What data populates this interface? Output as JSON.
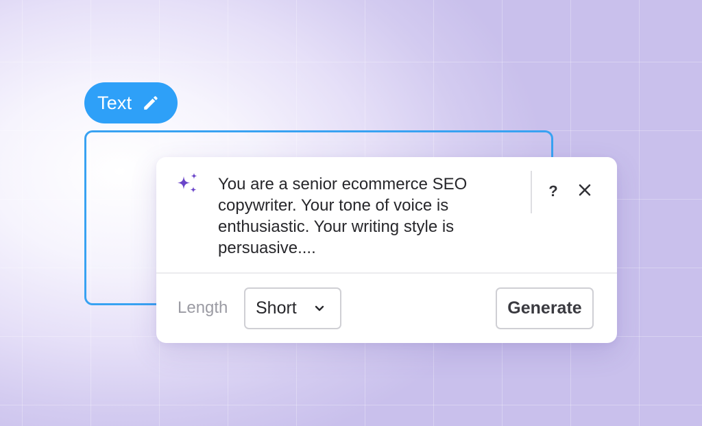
{
  "chip": {
    "label": "Text",
    "icon": "pencil-icon"
  },
  "popup": {
    "icon": "sparkle-icon",
    "prompt": "You are a senior ecommerce SEO copywriter. Your tone of voice is enthusiastic. Your writing style is persuasive....",
    "help_label": "?",
    "close_icon": "close-icon",
    "length_label": "Length",
    "length_value": "Short",
    "generate_label": "Generate"
  },
  "colors": {
    "accent": "#2ea0f8",
    "sparkle": "#6a45c9",
    "background": "#cfc7ef"
  }
}
